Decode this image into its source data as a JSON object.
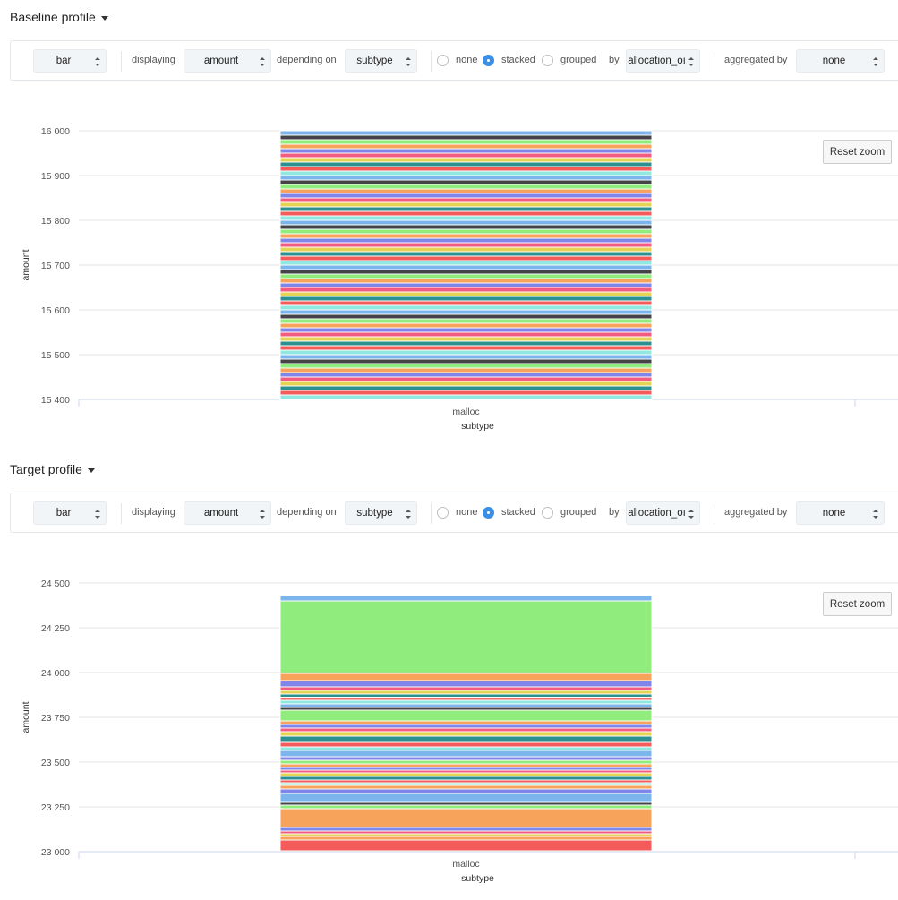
{
  "panels": [
    {
      "title": "Baseline profile",
      "toolbar": {
        "chart_type": "bar",
        "displaying_label": "displaying",
        "displaying_value": "amount",
        "depending_label": "depending on",
        "depending_value": "subtype",
        "mode_none": "none",
        "mode_stacked": "stacked",
        "mode_grouped": "grouped",
        "mode_selected": "stacked",
        "by_label": "by",
        "by_value": "allocation_oı",
        "aggregated_label": "aggregated by",
        "aggregated_value": "none"
      },
      "reset_label": "Reset zoom",
      "chart_data": {
        "type": "bar",
        "stacked": true,
        "categories": [
          "malloc"
        ],
        "xlabel": "subtype",
        "ylabel": "amount",
        "ylim": [
          15400,
          16000
        ],
        "yticks": [
          16000,
          15900,
          15800,
          15700,
          15600,
          15500,
          15400
        ],
        "ytick_labels": [
          "16 000",
          "15 900",
          "15 800",
          "15 700",
          "15 600",
          "15 500",
          "15 400"
        ],
        "grid": true,
        "bar_top": 16000,
        "segment_colors": [
          "#7cb5ec",
          "#434348",
          "#90ed7d",
          "#f7a35c",
          "#8085e9",
          "#f15c80",
          "#e4d354",
          "#2b908f",
          "#f45b5b",
          "#91e8e1"
        ]
      }
    },
    {
      "title": "Target profile",
      "toolbar": {
        "chart_type": "bar",
        "displaying_label": "displaying",
        "displaying_value": "amount",
        "depending_label": "depending on",
        "depending_value": "subtype",
        "mode_none": "none",
        "mode_stacked": "stacked",
        "mode_grouped": "grouped",
        "mode_selected": "stacked",
        "by_label": "by",
        "by_value": "allocation_oı",
        "aggregated_label": "aggregated by",
        "aggregated_value": "none"
      },
      "reset_label": "Reset zoom",
      "chart_data": {
        "type": "bar",
        "stacked": true,
        "categories": [
          "malloc"
        ],
        "xlabel": "subtype",
        "ylabel": "amount",
        "ylim": [
          23000,
          24500
        ],
        "yticks": [
          24500,
          24250,
          24000,
          23750,
          23500,
          23250,
          23000
        ],
        "ytick_labels": [
          "24 500",
          "24 250",
          "24 000",
          "23 750",
          "23 500",
          "23 250",
          "23 000"
        ],
        "grid": true,
        "bar_top": 24430,
        "segments": [
          {
            "from": 24400,
            "to": 24430,
            "color": "#7cb5ec"
          },
          {
            "from": 23995,
            "to": 24400,
            "color": "#90ed7d"
          },
          {
            "from": 23955,
            "to": 23995,
            "color": "#f7a35c"
          },
          {
            "from": 23920,
            "to": 23955,
            "color": "#8085e9"
          },
          {
            "from": 23900,
            "to": 23920,
            "color": "#f15c80"
          },
          {
            "from": 23880,
            "to": 23900,
            "color": "#e4d354"
          },
          {
            "from": 23862,
            "to": 23880,
            "color": "#2b908f"
          },
          {
            "from": 23845,
            "to": 23862,
            "color": "#f45b5b"
          },
          {
            "from": 23825,
            "to": 23845,
            "color": "#91e8e1"
          },
          {
            "from": 23805,
            "to": 23825,
            "color": "#7cb5ec"
          },
          {
            "from": 23790,
            "to": 23805,
            "color": "#434348"
          },
          {
            "from": 23730,
            "to": 23790,
            "color": "#90ed7d"
          },
          {
            "from": 23710,
            "to": 23730,
            "color": "#f7a35c"
          },
          {
            "from": 23690,
            "to": 23710,
            "color": "#8085e9"
          },
          {
            "from": 23670,
            "to": 23690,
            "color": "#f15c80"
          },
          {
            "from": 23645,
            "to": 23670,
            "color": "#e4d354"
          },
          {
            "from": 23610,
            "to": 23645,
            "color": "#2b908f"
          },
          {
            "from": 23585,
            "to": 23610,
            "color": "#f45b5b"
          },
          {
            "from": 23565,
            "to": 23585,
            "color": "#91e8e1"
          },
          {
            "from": 23530,
            "to": 23565,
            "color": "#7cb5ec"
          },
          {
            "from": 23510,
            "to": 23530,
            "color": "#8085e9"
          },
          {
            "from": 23490,
            "to": 23510,
            "color": "#90ed7d"
          },
          {
            "from": 23470,
            "to": 23490,
            "color": "#f7a35c"
          },
          {
            "from": 23455,
            "to": 23470,
            "color": "#8085e9"
          },
          {
            "from": 23440,
            "to": 23455,
            "color": "#f15c80"
          },
          {
            "from": 23420,
            "to": 23440,
            "color": "#e4d354"
          },
          {
            "from": 23400,
            "to": 23420,
            "color": "#2b908f"
          },
          {
            "from": 23385,
            "to": 23400,
            "color": "#f45b5b"
          },
          {
            "from": 23370,
            "to": 23385,
            "color": "#91e8e1"
          },
          {
            "from": 23350,
            "to": 23370,
            "color": "#f7a35c"
          },
          {
            "from": 23325,
            "to": 23350,
            "color": "#8085e9"
          },
          {
            "from": 23275,
            "to": 23325,
            "color": "#7cb5ec"
          },
          {
            "from": 23260,
            "to": 23275,
            "color": "#434348"
          },
          {
            "from": 23240,
            "to": 23260,
            "color": "#90ed7d"
          },
          {
            "from": 23135,
            "to": 23240,
            "color": "#f7a35c"
          },
          {
            "from": 23115,
            "to": 23135,
            "color": "#8085e9"
          },
          {
            "from": 23100,
            "to": 23115,
            "color": "#f15c80"
          },
          {
            "from": 23085,
            "to": 23100,
            "color": "#e4d354"
          },
          {
            "from": 23065,
            "to": 23085,
            "color": "#f7a35c"
          },
          {
            "from": 23005,
            "to": 23065,
            "color": "#f45b5b"
          }
        ]
      }
    }
  ]
}
